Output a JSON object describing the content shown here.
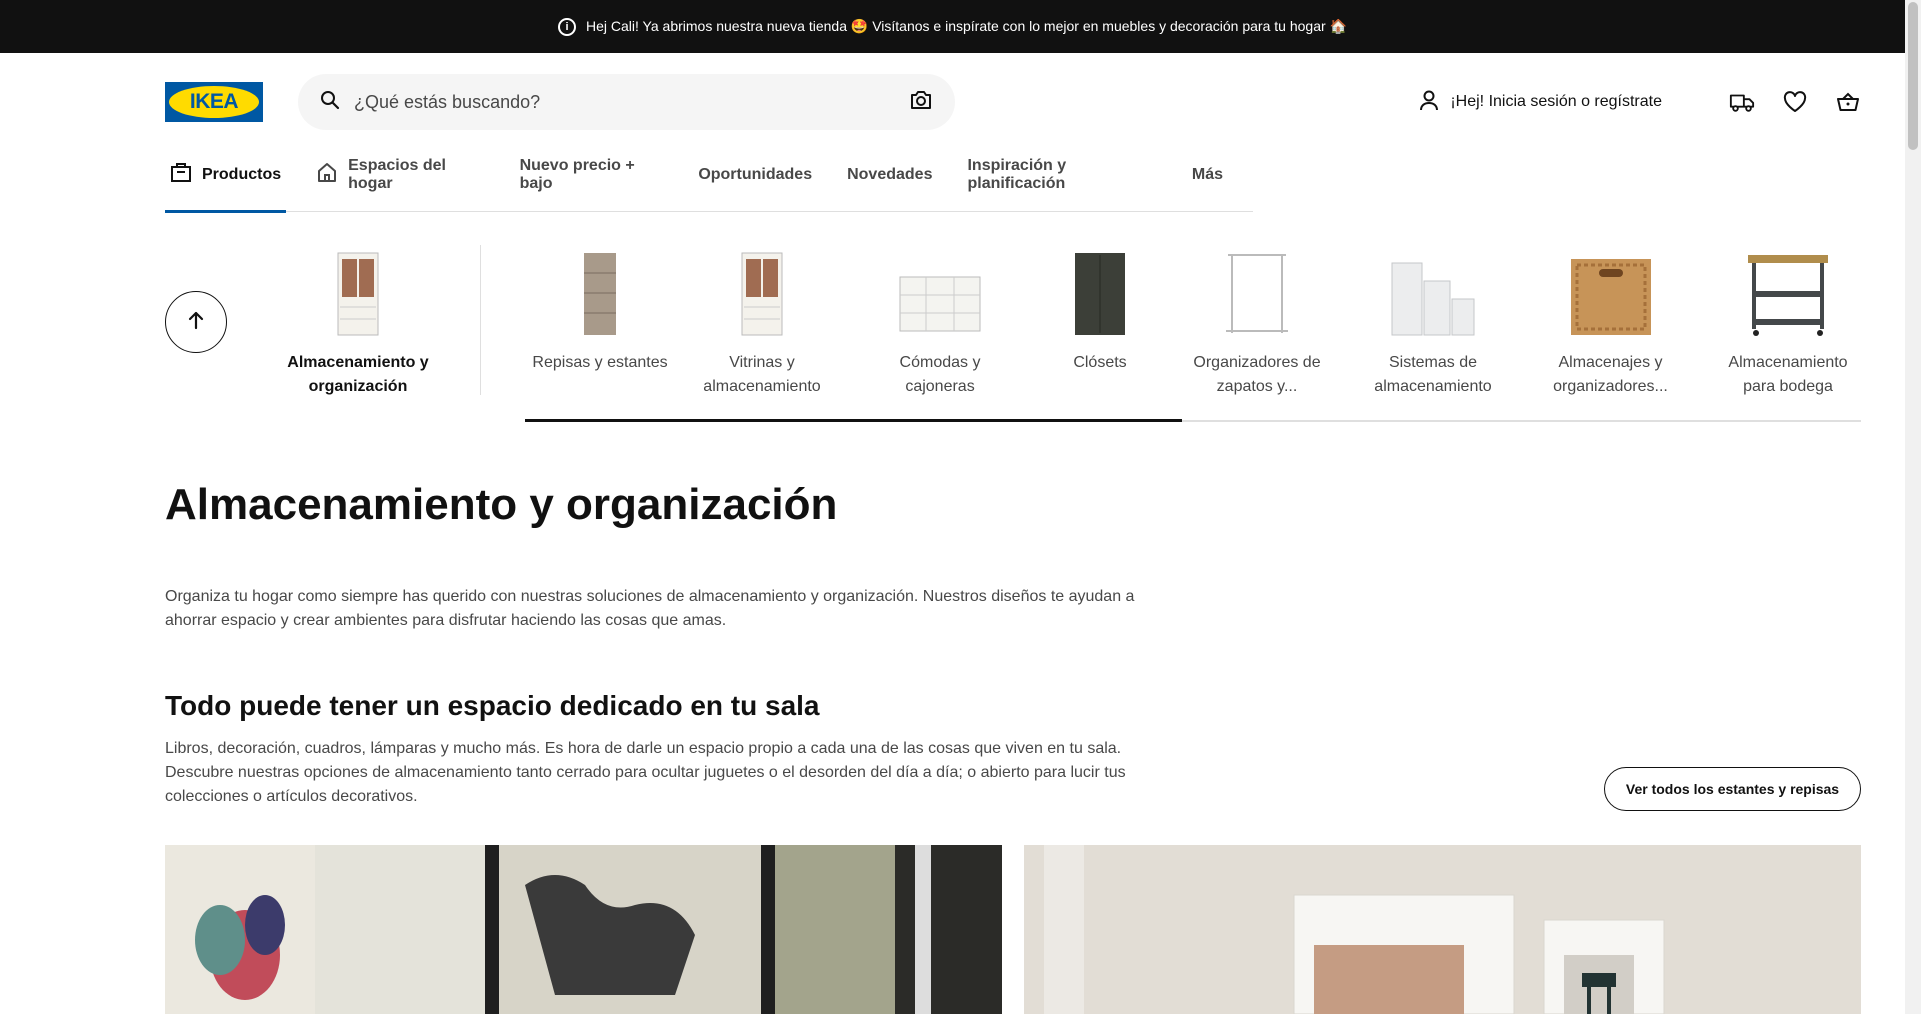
{
  "banner": {
    "text": "Hej Cali! Ya abrimos nuestra nueva tienda 🤩 Visítanos e inspírate con lo mejor en muebles y decoración para tu hogar 🏠",
    "icon": "info-icon"
  },
  "header": {
    "logo_text": "IKEA",
    "search_placeholder": "¿Qué estás buscando?",
    "login_label": "¡Hej! Inicia sesión o regístrate",
    "icons": [
      "user-icon",
      "delivery-truck-icon",
      "heart-icon",
      "cart-icon",
      "camera-icon",
      "search-icon"
    ]
  },
  "nav": {
    "items": [
      {
        "label": "Productos",
        "icon": "bag-icon"
      },
      {
        "label": "Espacios del hogar",
        "icon": "home-icon"
      },
      {
        "label": "Nuevo precio + bajo"
      },
      {
        "label": "Oportunidades"
      },
      {
        "label": "Novedades"
      },
      {
        "label": "Inspiración y planificación"
      },
      {
        "label": "Más"
      }
    ]
  },
  "categories": {
    "current": {
      "label": "Almacenamiento y organización"
    },
    "items": [
      {
        "label": "Repisas y estantes"
      },
      {
        "label": "Vitrinas y almacenamiento"
      },
      {
        "label": "Cómodas y cajoneras"
      },
      {
        "label": "Clósets"
      },
      {
        "label": "Organizadores de zapatos y..."
      },
      {
        "label": "Sistemas de almacenamiento"
      },
      {
        "label": "Almacenajes y organizadores..."
      },
      {
        "label": "Almacenamiento para bodega"
      }
    ]
  },
  "page": {
    "title": "Almacenamiento y organización",
    "intro": "Organiza tu hogar como siempre has querido con nuestras soluciones de almacenamiento y organización. Nuestros diseños te ayudan a ahorrar espacio y crear ambientes para disfrutar haciendo  las cosas que amas.",
    "section_title": "Todo puede tener un espacio dedicado en tu sala",
    "section_desc": "Libros, decoración, cuadros, lámparas y mucho más. Es hora de darle un espacio propio a cada una de las cosas que viven en tu sala. Descubre nuestras opciones de almacenamiento tanto cerrado para ocultar juguetes o el desorden del día a día; o abierto para lucir tus colecciones o artículos decorativos.",
    "see_all_label": "Ver todos los estantes y repisas"
  },
  "colors": {
    "brand_blue": "#0058a3",
    "brand_yellow": "#ffdb00",
    "banner_bg": "#111111"
  }
}
